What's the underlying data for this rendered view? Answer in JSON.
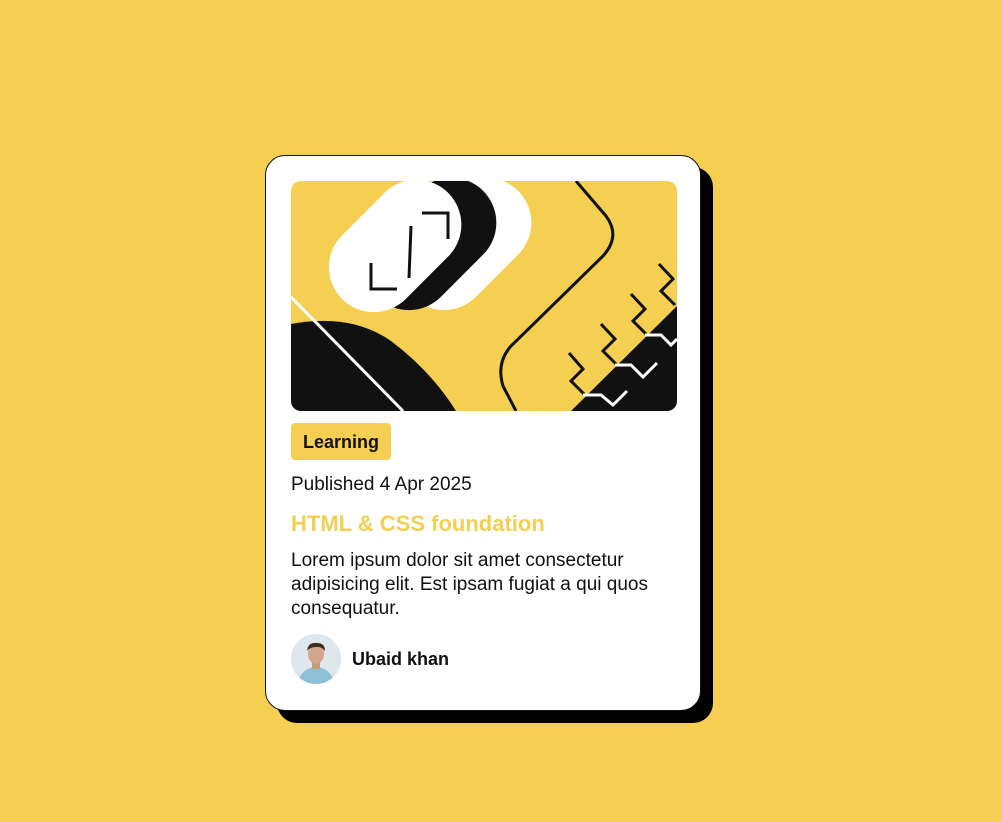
{
  "card": {
    "tag": "Learning",
    "published": "Published 4 Apr 2025",
    "title": "HTML & CSS foundation",
    "description": "Lorem ipsum dolor sit amet consectetur adipisicing elit. Est ipsam fugiat a qui quos consequatur.",
    "author": {
      "name": "Ubaid khan"
    }
  },
  "colors": {
    "background": "#f5cf52",
    "card": "#ffffff",
    "shadow": "#000000",
    "accent": "#f5cf52",
    "text": "#111111"
  }
}
